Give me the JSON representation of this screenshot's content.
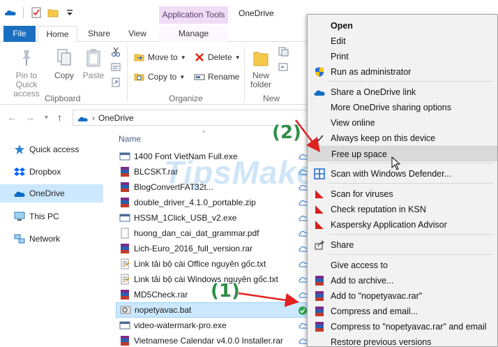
{
  "window": {
    "title": "OneDrive",
    "context_tab": "Application Tools"
  },
  "ribbon_tabs": {
    "file": "File",
    "home": "Home",
    "share": "Share",
    "view": "View",
    "manage": "Manage"
  },
  "ribbon": {
    "pin_line1": "Pin to Quick",
    "pin_line2": "access",
    "copy": "Copy",
    "paste": "Paste",
    "clipboard": "Clipboard",
    "move_to": "Move to",
    "copy_to": "Copy to",
    "delete": "Delete",
    "rename": "Rename",
    "organize": "Organize",
    "new_folder_line1": "New",
    "new_folder_line2": "folder",
    "new": "New"
  },
  "address": {
    "path": "OneDrive"
  },
  "navigation": {
    "items": [
      "Quick access",
      "Dropbox",
      "OneDrive",
      "This PC",
      "Network"
    ]
  },
  "file_list": {
    "column_name": "Name",
    "files": [
      "1400 Font VietNam Full.exe",
      "BLCSKT.rar",
      "BlogConvertFAT32t...",
      "double_driver_4.1.0_portable.zip",
      "HSSM_1Click_USB_v2.exe",
      "huong_dan_cai_dat_grammar.pdf",
      "Lich-Euro_2016_full_version.rar",
      "Link tải bộ cài Office nguyên gốc.txt",
      "Link tải bộ cài Windows nguyên gốc.txt",
      "MD5Check.rar",
      "nopetyavac.bat",
      "video-watermark-pro.exe",
      "Vietnamese Calendar v4.0.0 Installer.rar"
    ]
  },
  "watermark": "TipsMake",
  "annotations": {
    "step1": "(1)",
    "step2": "(2)"
  },
  "context_menu": {
    "items": [
      "Open",
      "Edit",
      "Print",
      "Run as administrator",
      "Share a OneDrive link",
      "More OneDrive sharing options",
      "View online",
      "Always keep on this device",
      "Free up space",
      "Scan with Windows Defender...",
      "Scan for viruses",
      "Check reputation in KSN",
      "Kaspersky Application Advisor",
      "Share",
      "Give access to",
      "Add to archive...",
      "Add to \"nopetyavac.rar\"",
      "Compress and email...",
      "Compress to \"nopetyavac.rar\" and email",
      "Restore previous versions"
    ]
  },
  "colors": {
    "accent": "#1a6fc0",
    "selection": "#cce8ff",
    "annotation_green": "#2f8e47",
    "annotation_arrow": "#e02020",
    "menu_bg": "#f2f2f2"
  }
}
